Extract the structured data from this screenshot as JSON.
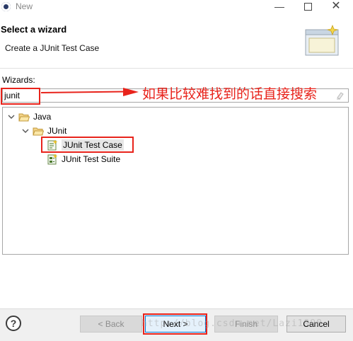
{
  "window": {
    "title": "New",
    "minimize": "—",
    "close": "✕"
  },
  "header": {
    "title": "Select a wizard",
    "description": "Create a JUnit Test Case"
  },
  "wizards": {
    "label": "Wizards:",
    "filter_value": "junit"
  },
  "tree": {
    "items": [
      {
        "label": "Java",
        "icon": "folder-open-icon",
        "expanded": true
      },
      {
        "label": "JUnit",
        "icon": "folder-open-icon",
        "expanded": true
      },
      {
        "label": "JUnit Test Case",
        "icon": "junit-test-case-icon",
        "selected": true
      },
      {
        "label": "JUnit Test Suite",
        "icon": "junit-test-suite-icon",
        "selected": false
      }
    ]
  },
  "annotation": {
    "text": "如果比较难找到的话直接搜索",
    "color": "#e8231b"
  },
  "footer": {
    "help": "?",
    "back_label": "< Back",
    "next_label": "Next >",
    "finish_label": "Finish",
    "cancel_label": "Cancel"
  },
  "watermark": "http://blog.csdn.net/Lazi1998"
}
